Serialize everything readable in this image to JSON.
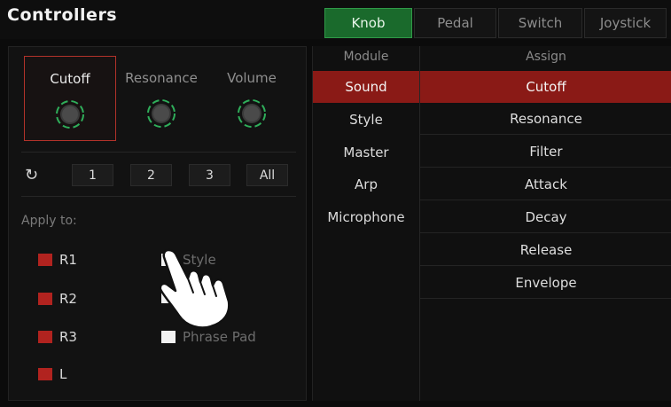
{
  "header": {
    "title": "Controllers",
    "tabs": [
      "Knob",
      "Pedal",
      "Switch",
      "Joystick"
    ],
    "active_tab": "Knob"
  },
  "knobs": [
    {
      "label": "Cutoff",
      "selected": true
    },
    {
      "label": "Resonance",
      "selected": false
    },
    {
      "label": "Volume",
      "selected": false
    }
  ],
  "presets": {
    "reset_icon": "refresh-icon",
    "buttons": [
      "1",
      "2",
      "3",
      "All"
    ]
  },
  "apply": {
    "label": "Apply to:",
    "parts": [
      "R1",
      "R2",
      "R3",
      "L"
    ],
    "targets": [
      "Style",
      "",
      "Phrase Pad"
    ]
  },
  "table": {
    "module_header": "Module",
    "assign_header": "Assign",
    "modules": [
      "Sound",
      "Style",
      "Master",
      "Arp",
      "Microphone"
    ],
    "selected_module": "Sound",
    "assigns": [
      "Cutoff",
      "Resonance",
      "Filter",
      "Attack",
      "Decay",
      "Release",
      "Envelope"
    ],
    "selected_assign": "Cutoff"
  },
  "colors": {
    "active_tab": "#1a6a2c",
    "selection": "#8a1a16",
    "checkbox_red": "#b1231f",
    "knob_ring": "#2fae5a"
  }
}
